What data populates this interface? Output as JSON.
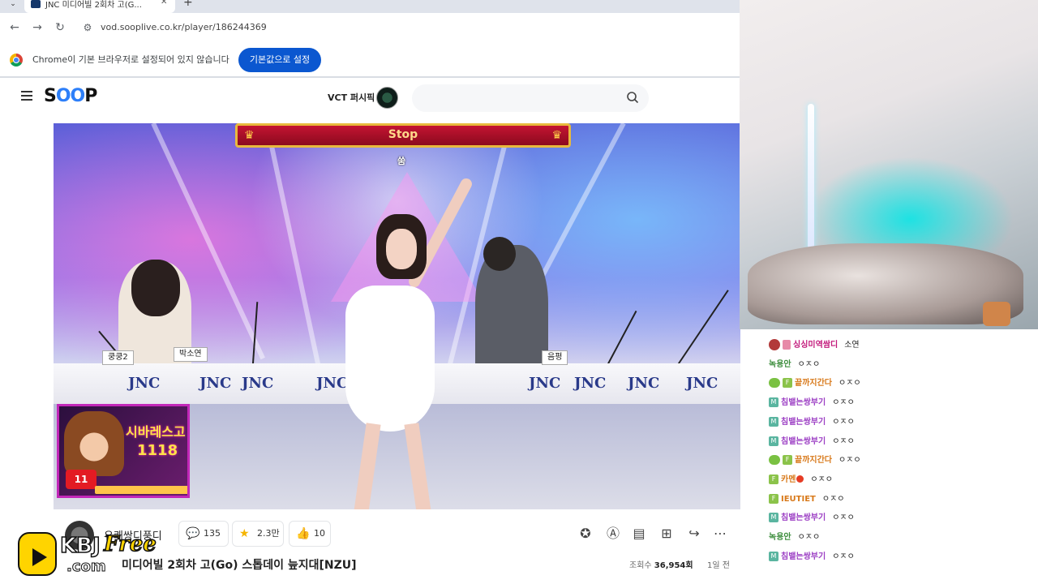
{
  "browser": {
    "tab_title": "JNC 미디어빌 2회차 고(G...",
    "url": "vod.sooplive.co.kr/player/186244369",
    "infobar_text": "Chrome이 기본 브라우저로 설정되어 있지 않습니다",
    "infobar_button": "기본값으로 설정"
  },
  "header": {
    "logo": "SOOP",
    "channel_name": "VCT 퍼시픽"
  },
  "video": {
    "banner_text": "Stop",
    "subtitle_char": "쑴",
    "nameplates": [
      "쿵쿵2",
      "박소연",
      "음평"
    ],
    "desk_logo": "JNC",
    "ad_title": "시바레스고",
    "ad_number": "1118",
    "ad_badge": "11"
  },
  "meta": {
    "uploader": "유쾌쌍디풍디",
    "comments": "135",
    "favorites": "2.3만",
    "likes": "10",
    "title_visible": "미디어빌 2회차 고(Go) 스톱데이 늪지대[NZU]",
    "views_label": "조회수",
    "views": "36,954회",
    "age": "1일 전"
  },
  "watermark": {
    "kbj": "KBJ",
    "free": "Free",
    "com": ".com"
  },
  "chat": [
    {
      "badge": "r",
      "nick": "싱싱미역쌈디",
      "color": "pink",
      "msg": "소연"
    },
    {
      "badge": "",
      "nick": "녹용안",
      "color": "green",
      "msg": "ㅇㅈㅇ"
    },
    {
      "badge": "wf",
      "nick": "끝까지간다",
      "color": "orange",
      "msg": "ㅇㅈㅇ"
    },
    {
      "badge": "m",
      "nick": "침뱉는쌍부기",
      "color": "purple",
      "msg": "ㅇㅈㅇ"
    },
    {
      "badge": "m",
      "nick": "침뱉는쌍부기",
      "color": "purple",
      "msg": "ㅇㅈㅇ"
    },
    {
      "badge": "m",
      "nick": "침뱉는쌍부기",
      "color": "purple",
      "msg": "ㅇㅈㅇ"
    },
    {
      "badge": "wf",
      "nick": "끝까지간다",
      "color": "orange",
      "msg": "ㅇㅈㅇ"
    },
    {
      "badge": "f",
      "nick": "카멘",
      "color": "orange",
      "msg": "ㅇㅈㅇ"
    },
    {
      "badge": "f",
      "nick": "IEUTIET",
      "color": "orange",
      "msg": "ㅇㅈㅇ"
    },
    {
      "badge": "m",
      "nick": "침뱉는쌍부기",
      "color": "purple",
      "msg": "ㅇㅈㅇ"
    },
    {
      "badge": "",
      "nick": "녹용안",
      "color": "green",
      "msg": "ㅇㅈㅇ"
    },
    {
      "badge": "m",
      "nick": "침뱉는쌍부기",
      "color": "purple",
      "msg": "ㅇㅈㅇ"
    }
  ],
  "colors": {
    "accent_blue": "#0b57d0",
    "soop_blue": "#2d7ff9",
    "banner_red": "#c41432"
  }
}
